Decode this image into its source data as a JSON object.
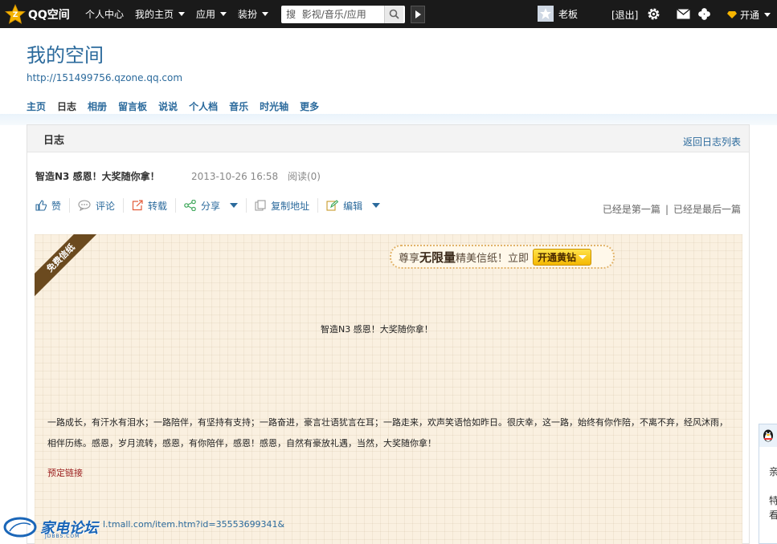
{
  "topbar": {
    "logo_text": "QQ空间",
    "nav": [
      "个人中心",
      "我的主页",
      "应用",
      "装扮"
    ],
    "search_placeholder": "搜  影视/音乐/应用",
    "username": "老板",
    "logout": "[退出]",
    "vip": "开通"
  },
  "header": {
    "title": "我的空间",
    "url": "http://151499756.qzone.qq.com",
    "nav": [
      "主页",
      "日志",
      "相册",
      "留言板",
      "说说",
      "个人档",
      "音乐",
      "时光轴",
      "更多"
    ]
  },
  "panel": {
    "title": "日志",
    "back": "返回日志列表"
  },
  "post": {
    "title": "智造N3 感恩！大奖随你拿！",
    "date": "2013-10-26 16:58",
    "reads": "阅读(0)",
    "actions": [
      "赞",
      "评论",
      "转载",
      "分享",
      "复制地址",
      "编辑"
    ],
    "pager_first": "已经是第一篇",
    "pager_last": "已经是最后一篇"
  },
  "paper": {
    "ribbon": "免费信纸",
    "promo_prefix": "尊享",
    "promo_bold": "无限量",
    "promo_suffix": "精美信纸！立即",
    "promo_button": "开通黄钻",
    "body_title": "智造N3 感恩！大奖随你拿！",
    "body_text": "一路成长，有汗水有泪水；一路陪伴，有坚持有支持；一路奋进，豪言壮语犹言在耳；一路走来，欢声笑语恰如昨日。很庆幸，这一路，始终有你作陪，不离不弃，经风沐雨，相伴历练。感恩，岁月流转，感恩，有你陪伴，感恩！感恩，自然有豪放礼遇，当然，大奖随你拿！",
    "reserve_link": "预定链接",
    "url": "l.tmall.com/item.htm?id=35553699341&"
  },
  "watermark": {
    "text": "家电论坛",
    "sub": "JDBBS.COM"
  },
  "side": {
    "t1": "亲",
    "t2": "特",
    "t3": "看"
  },
  "colors": {
    "topbar": "#1a1a1a",
    "link": "#2b6a9c",
    "paper": "#faf0e0",
    "ribbon": "#6b4a1f",
    "promo_button": "#f5b800"
  }
}
